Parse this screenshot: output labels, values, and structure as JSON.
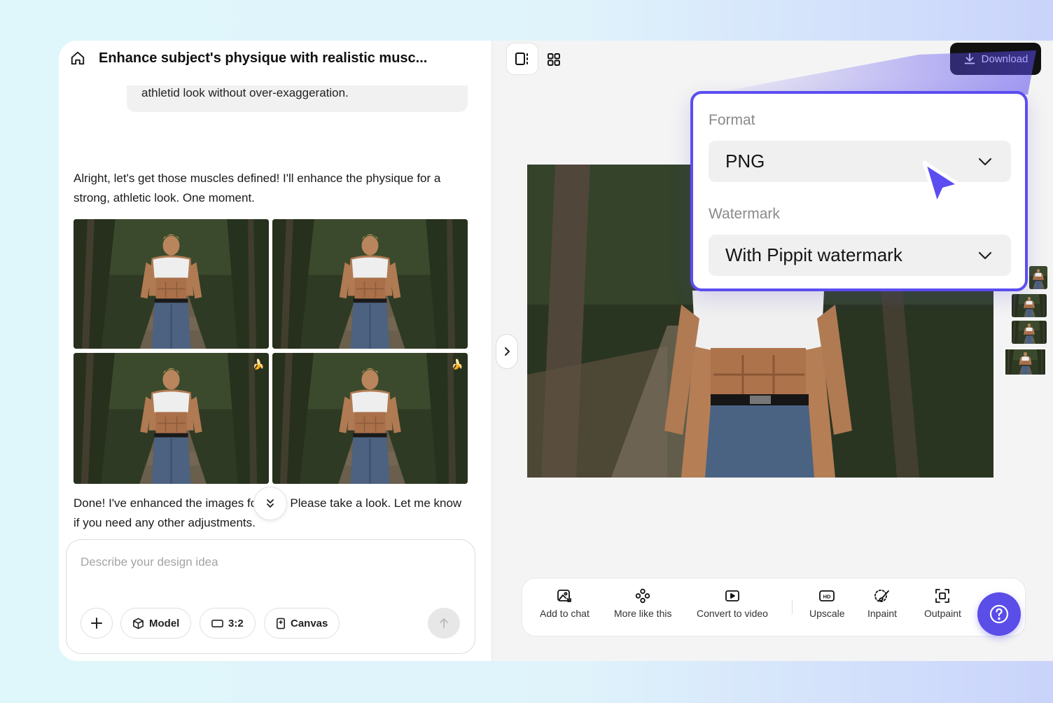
{
  "header": {
    "title": "Enhance subject's physique with realistic musc..."
  },
  "chat": {
    "user_message_tail": "athletid look without over-exaggeration.",
    "assistant_intro": "Alright, let's get those muscles defined! I'll enhance the physique for a strong, athletic look. One moment.",
    "badge_emoji": "🍌",
    "assistant_done": "Done! I've enhanced the images for you. Please take a look. Let me know if you need any other adjustments."
  },
  "composer": {
    "placeholder": "Describe your design idea",
    "model_label": "Model",
    "ratio_label": "3:2",
    "canvas_label": "Canvas"
  },
  "canvas_panel": {
    "download_label": "Download"
  },
  "toolbar": {
    "add_to_chat": "Add to chat",
    "more_like_this": "More like this",
    "convert_to_video": "Convert to video",
    "upscale": "Upscale",
    "inpaint": "Inpaint",
    "outpaint": "Outpaint"
  },
  "download_popover": {
    "format_label": "Format",
    "format_value": "PNG",
    "watermark_label": "Watermark",
    "watermark_value": "With Pippit watermark"
  },
  "colors": {
    "accent": "#5b4df0",
    "download_bg": "#111111",
    "help_bg": "#5a4de8"
  }
}
